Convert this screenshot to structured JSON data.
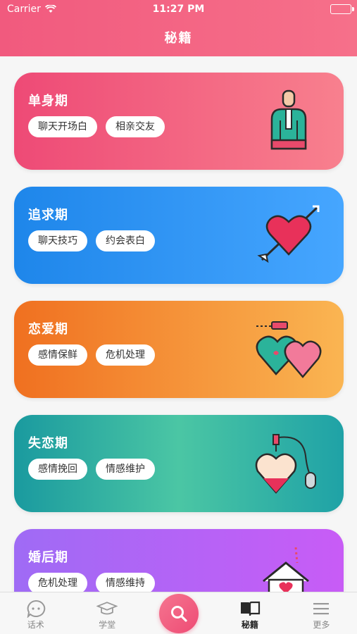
{
  "status_bar": {
    "carrier": "Carrier",
    "time": "11:27 PM"
  },
  "nav": {
    "title": "秘籍"
  },
  "cards": [
    {
      "title": "单身期",
      "tags": [
        "聊天开场白",
        "相亲交友"
      ],
      "icon": "person-icon"
    },
    {
      "title": "追求期",
      "tags": [
        "聊天技巧",
        "约会表白"
      ],
      "icon": "heart-arrow-icon"
    },
    {
      "title": "恋爱期",
      "tags": [
        "感情保鲜",
        "危机处理"
      ],
      "icon": "double-heart-icon"
    },
    {
      "title": "失恋期",
      "tags": [
        "感情挽回",
        "情感维护"
      ],
      "icon": "heart-bottle-icon"
    },
    {
      "title": "婚后期",
      "tags": [
        "危机处理",
        "情感维持"
      ],
      "icon": "house-heart-icon"
    }
  ],
  "tabbar": {
    "items": [
      {
        "label": "话术",
        "icon": "chat-bubble-icon"
      },
      {
        "label": "学堂",
        "icon": "graduation-cap-icon"
      },
      {
        "label": "",
        "icon": "search-icon"
      },
      {
        "label": "秘籍",
        "icon": "book-icon"
      },
      {
        "label": "更多",
        "icon": "menu-icon"
      }
    ],
    "active": "秘籍"
  },
  "colors": {
    "header": "#f15a7e",
    "accent": "#ee4b74"
  }
}
